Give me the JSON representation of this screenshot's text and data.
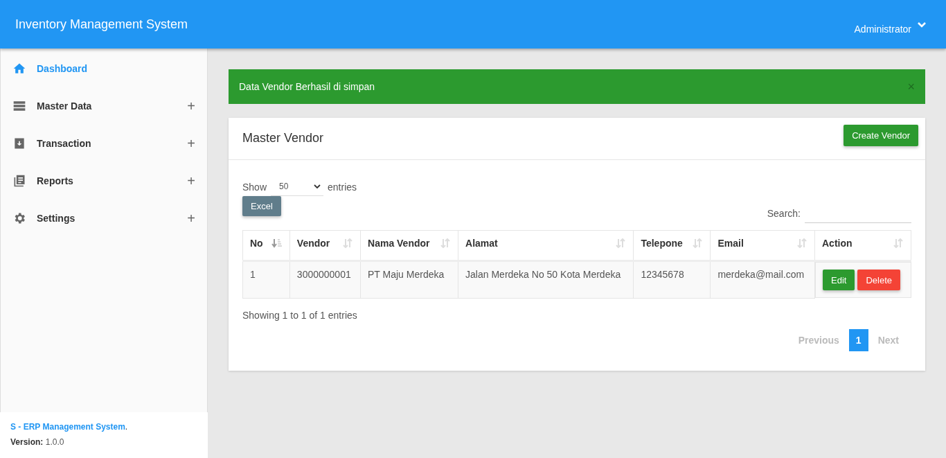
{
  "header": {
    "title": "Inventory Management System",
    "user": "Administrator"
  },
  "sidebar": {
    "items": [
      {
        "label": "Dashboard",
        "kind": "link",
        "selected": true
      },
      {
        "label": "Master Data",
        "kind": "group",
        "selected": false,
        "expanded": false,
        "toggle": "+"
      },
      {
        "label": "Transaction",
        "kind": "group",
        "selected": false,
        "expanded": false,
        "toggle": "+"
      },
      {
        "label": "Reports",
        "kind": "group",
        "selected": false,
        "expanded": false,
        "toggle": "+"
      },
      {
        "label": "Settings",
        "kind": "group",
        "selected": false,
        "expanded": false,
        "toggle": "+"
      }
    ],
    "footer": {
      "brand": "S - ERP Management System",
      "brand_suffix": ".",
      "version_label": "Version:",
      "version": "1.0.0"
    }
  },
  "alert": {
    "message": "Data Vendor Berhasil di simpan",
    "close": "×"
  },
  "card": {
    "title": "Master Vendor",
    "create_button": "Create Vendor",
    "length": {
      "before": "Show",
      "value": "50",
      "after": "entries"
    },
    "excel_button": "Excel",
    "search_label": "Search:",
    "table": {
      "columns": [
        {
          "label": "No",
          "sorted": true
        },
        {
          "label": "Vendor",
          "sorted": false
        },
        {
          "label": "Nama Vendor",
          "sorted": false
        },
        {
          "label": "Alamat",
          "sorted": false
        },
        {
          "label": "Telepone",
          "sorted": false
        },
        {
          "label": "Email",
          "sorted": false
        },
        {
          "label": "Action",
          "sorted": false
        }
      ],
      "rows": [
        {
          "cells": [
            "1",
            "3000000001",
            "PT Maju Merdeka",
            "Jalan Merdeka No 50 Kota Merdeka",
            "12345678",
            "merdeka@mail.com"
          ],
          "actions": [
            {
              "label": "Edit",
              "kind": "edit"
            },
            {
              "label": "Delete",
              "kind": "delete"
            }
          ]
        }
      ]
    },
    "info": "Showing 1 to 1 of 1 entries",
    "pagination": [
      {
        "label": "Previous",
        "disabled": true,
        "selected": false
      },
      {
        "label": "1",
        "disabled": false,
        "selected": true
      },
      {
        "label": "Next",
        "disabled": true,
        "selected": false
      }
    ]
  }
}
